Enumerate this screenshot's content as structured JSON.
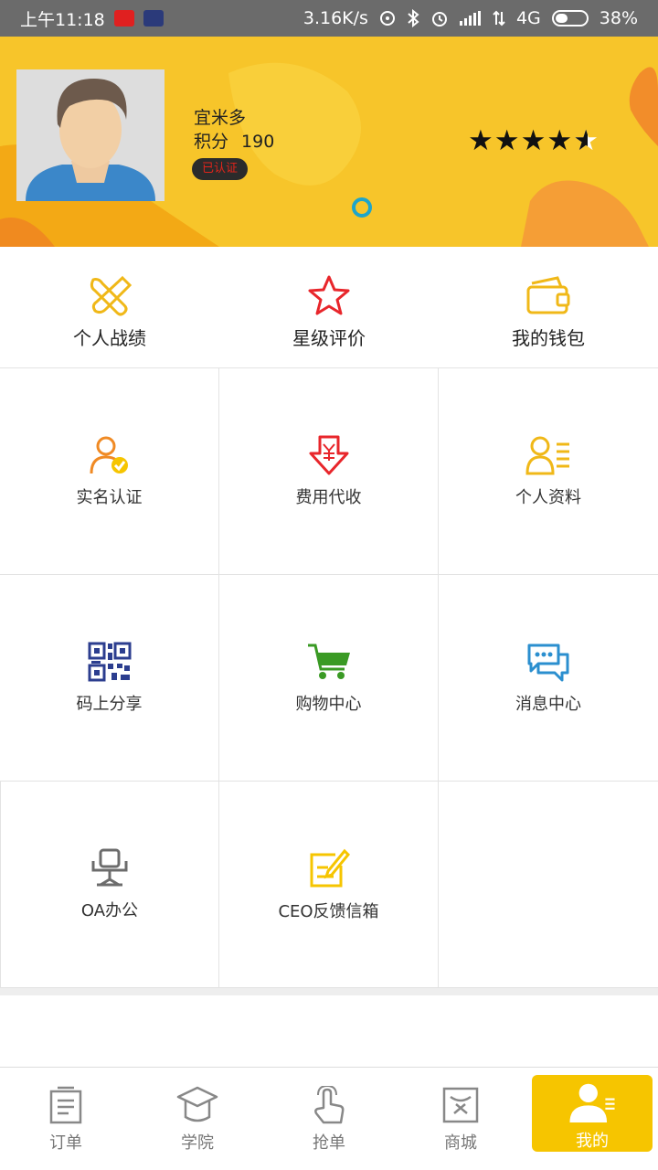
{
  "status_bar": {
    "time": "上午11:18",
    "network_speed": "3.16K/s",
    "network_type": "4G",
    "battery": "38%"
  },
  "profile": {
    "name": "宜米多",
    "points_label": "积分",
    "points_value": "190",
    "verified_label": "已认证",
    "rating": 4.5,
    "accent_color": "#f7c52a"
  },
  "top_menu": [
    {
      "label": "个人战绩",
      "icon": "tools-icon"
    },
    {
      "label": "星级评价",
      "icon": "star-icon"
    },
    {
      "label": "我的钱包",
      "icon": "wallet-icon"
    }
  ],
  "grid_menu": [
    {
      "label": "实名认证",
      "icon": "user-verify-icon"
    },
    {
      "label": "费用代收",
      "icon": "yuan-download-icon"
    },
    {
      "label": "个人资料",
      "icon": "profile-list-icon"
    },
    {
      "label": "码上分享",
      "icon": "qr-code-icon"
    },
    {
      "label": "购物中心",
      "icon": "cart-icon"
    },
    {
      "label": "消息中心",
      "icon": "chat-icon"
    },
    {
      "label": "OA办公",
      "icon": "office-chair-icon"
    },
    {
      "label": "CEO反馈信箱",
      "icon": "feedback-edit-icon"
    }
  ],
  "tab_bar": [
    {
      "label": "订单",
      "icon": "order-doc-icon"
    },
    {
      "label": "学院",
      "icon": "graduation-cap-icon"
    },
    {
      "label": "抢单",
      "icon": "tap-hand-icon"
    },
    {
      "label": "商城",
      "icon": "shop-icon"
    },
    {
      "label": "我的",
      "icon": "me-person-icon",
      "active": true
    }
  ]
}
